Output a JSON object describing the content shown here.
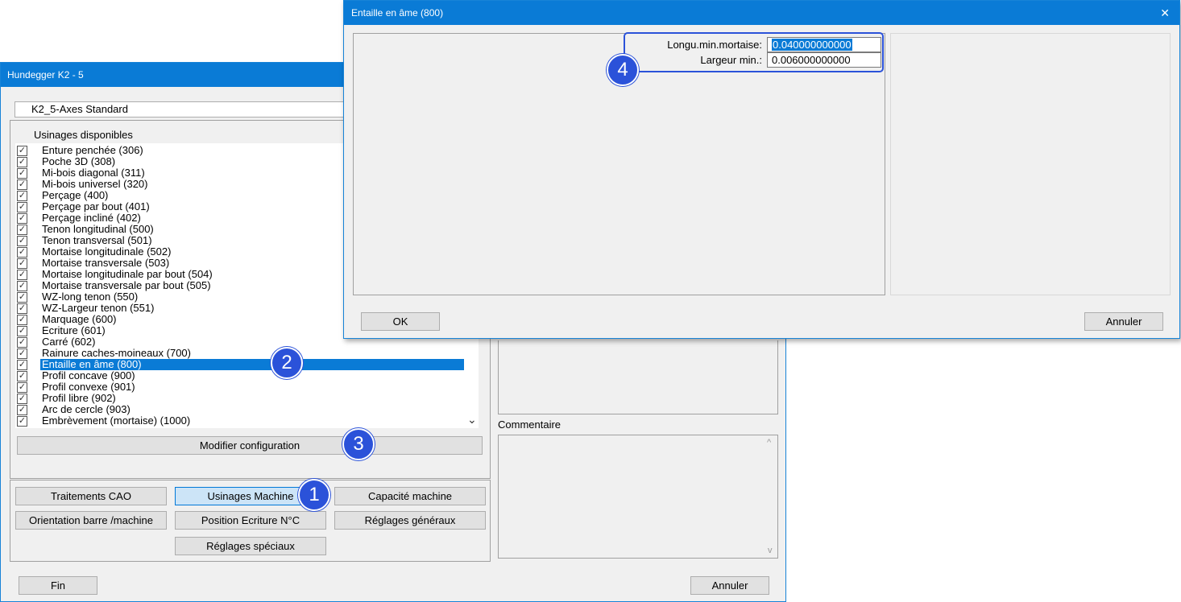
{
  "main_window": {
    "title": "Hundegger K2 - 5",
    "machine_select": "K2_5-Axes Standard",
    "list_label": "Usinages disponibles",
    "items": [
      {
        "label": "Enture penchée  (306)",
        "checked": true
      },
      {
        "label": "Poche 3D (308)",
        "checked": true
      },
      {
        "label": "Mi-bois diagonal (311)",
        "checked": true
      },
      {
        "label": "Mi-bois universel (320)",
        "checked": true
      },
      {
        "label": "Perçage (400)",
        "checked": true
      },
      {
        "label": "Perçage par bout (401)",
        "checked": true
      },
      {
        "label": "Perçage incliné (402)",
        "checked": true
      },
      {
        "label": "Tenon longitudinal (500)",
        "checked": true
      },
      {
        "label": "Tenon transversal (501)",
        "checked": true
      },
      {
        "label": "Mortaise longitudinale (502)",
        "checked": true
      },
      {
        "label": "Mortaise transversale (503)",
        "checked": true
      },
      {
        "label": "Mortaise longitudinale par bout (504)",
        "checked": true
      },
      {
        "label": "Mortaise transversale par bout (505)",
        "checked": true
      },
      {
        "label": "WZ-long tenon (550)",
        "checked": true
      },
      {
        "label": "WZ-Largeur tenon (551)",
        "checked": true
      },
      {
        "label": "Marquage (600)",
        "checked": true
      },
      {
        "label": "Ecriture (601)",
        "checked": true
      },
      {
        "label": "Carré (602)",
        "checked": true
      },
      {
        "label": "Rainure caches-moineaux (700)",
        "checked": true
      },
      {
        "label": "Entaille en âme (800)",
        "checked": true,
        "selected": true
      },
      {
        "label": "Profil concave (900)",
        "checked": true
      },
      {
        "label": "Profil convexe (901)",
        "checked": true
      },
      {
        "label": "Profil libre (902)",
        "checked": true
      },
      {
        "label": "Arc de cercle (903)",
        "checked": true
      },
      {
        "label": "Embrèvement (mortaise)  (1000)",
        "checked": true
      }
    ],
    "modify_config": "Modifier configuration",
    "nav_buttons": {
      "traitements_cao": "Traitements CAO",
      "usinages_machine": "Usinages Machine",
      "capacite_machine": "Capacité machine",
      "orientation": "Orientation barre /machine",
      "position_ecriture": "Position Ecriture N°C",
      "reglages_generaux": "Réglages généraux",
      "reglages_speciaux": "Réglages spéciaux"
    },
    "comment_label": "Commentaire",
    "fin": "Fin",
    "annuler": "Annuler"
  },
  "dialog": {
    "title": "Entaille en âme (800)",
    "close_glyph": "✕",
    "fields": [
      {
        "label": "Longu.min.mortaise:",
        "value": "0.040000000000",
        "selected": true
      },
      {
        "label": "Largeur min.:",
        "value": "0.006000000000"
      }
    ],
    "ok": "OK",
    "annuler": "Annuler"
  },
  "badges": [
    "1",
    "2",
    "3",
    "4"
  ],
  "accent_color": "#2b52d9",
  "check_glyph": "✓",
  "scroll_down_glyph": "⌄",
  "scroll_up_glyph": "^",
  "scroll_down_small": "v"
}
